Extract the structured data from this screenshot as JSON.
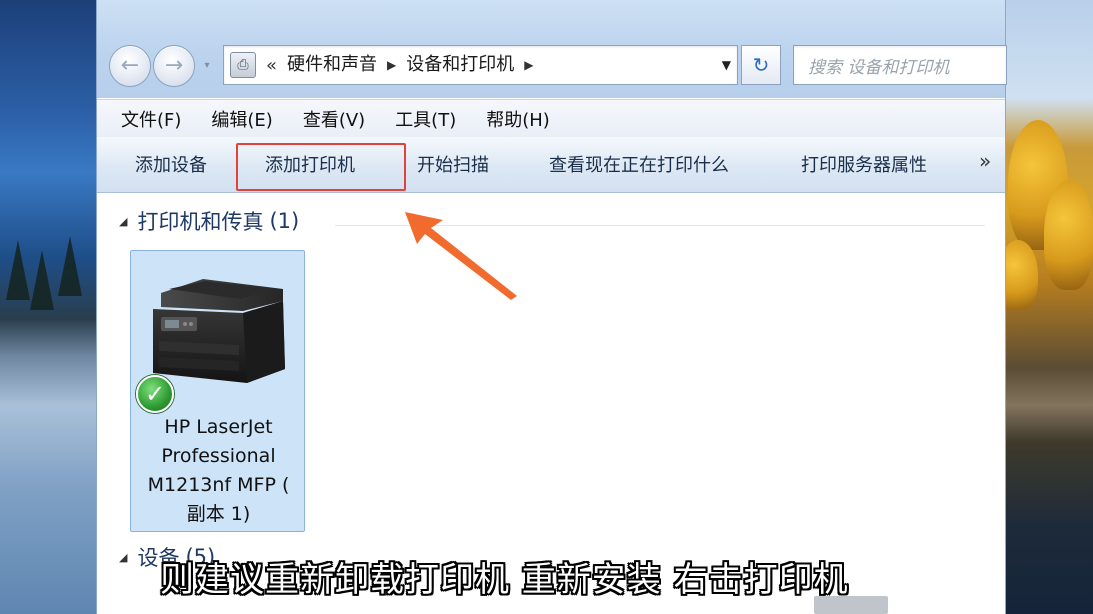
{
  "address_bar": {
    "overflow": "«",
    "breadcrumbs": [
      "硬件和声音",
      "设备和打印机"
    ],
    "search_placeholder": "搜索 设备和打印机"
  },
  "menu": [
    "文件(F)",
    "编辑(E)",
    "查看(V)",
    "工具(T)",
    "帮助(H)"
  ],
  "commands": {
    "add_device": "添加设备",
    "add_printer": "添加打印机",
    "start_scan": "开始扫描",
    "see_printing": "查看现在正在打印什么",
    "print_server": "打印服务器属性",
    "more": "»"
  },
  "groups": {
    "printers": {
      "title": "打印机和传真",
      "count": "(1)"
    },
    "devices": {
      "title": "设备",
      "count": "(5)"
    }
  },
  "printer": {
    "name": "HP LaserJet\nProfessional\nM1213nf MFP (\n副本 1)",
    "status": "default"
  },
  "subtitle": "则建议重新卸载打印机 重新安装 右击打印机",
  "colors": {
    "highlight": "#e3413c",
    "arrow": "#f26b2e",
    "group_title": "#1e3966",
    "selected_tile": "#cde3f7"
  }
}
